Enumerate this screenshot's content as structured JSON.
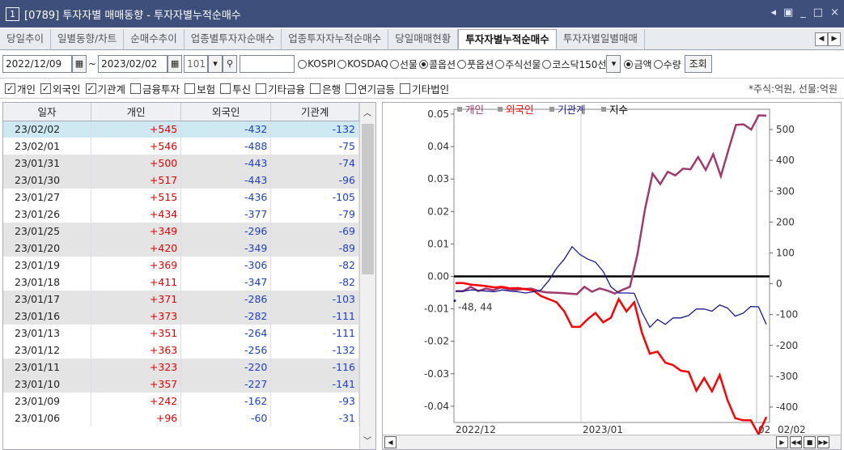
{
  "window": {
    "number": "1",
    "title": "[0789] 투자자별 매매동향 - 투자자별누적순매수"
  },
  "tabs": [
    "당일추이",
    "일별동향/차트",
    "순매수추이",
    "업종별투자자순매수",
    "업종투자자누적순매수",
    "당일매매현황",
    "투자자별누적순매수",
    "투자자별일별매매"
  ],
  "active_tab": 6,
  "toolbar": {
    "date_from": "2022/12/09",
    "date_to": "2023/02/02",
    "count": "101",
    "search_value": "",
    "markets": [
      "KOSPI",
      "KOSDAQ",
      "선물",
      "콜옵션",
      "풋옵션",
      "주식선물",
      "코스닥150선"
    ],
    "market_selected": 3,
    "units": [
      "금액",
      "수량"
    ],
    "unit_selected": 0,
    "query_label": "조회"
  },
  "checkboxes": [
    {
      "label": "개인",
      "checked": true
    },
    {
      "label": "외국인",
      "checked": true
    },
    {
      "label": "기관계",
      "checked": true
    },
    {
      "label": "금융투자",
      "checked": false
    },
    {
      "label": "보험",
      "checked": false
    },
    {
      "label": "투신",
      "checked": false
    },
    {
      "label": "기타금융",
      "checked": false
    },
    {
      "label": "은행",
      "checked": false
    },
    {
      "label": "연기금등",
      "checked": false
    },
    {
      "label": "기타법인",
      "checked": false
    }
  ],
  "unit_note": "*주식:억원, 선물:억원",
  "table": {
    "headers": [
      "일자",
      "개인",
      "외국인",
      "기관계"
    ],
    "rows": [
      [
        "23/02/02",
        "+545",
        "-432",
        "-132"
      ],
      [
        "23/02/01",
        "+546",
        "-488",
        "-75"
      ],
      [
        "23/01/31",
        "+500",
        "-443",
        "-74"
      ],
      [
        "23/01/30",
        "+517",
        "-443",
        "-96"
      ],
      [
        "23/01/27",
        "+515",
        "-436",
        "-105"
      ],
      [
        "23/01/26",
        "+434",
        "-377",
        "-79"
      ],
      [
        "23/01/25",
        "+349",
        "-296",
        "-69"
      ],
      [
        "23/01/20",
        "+420",
        "-349",
        "-89"
      ],
      [
        "23/01/19",
        "+369",
        "-306",
        "-82"
      ],
      [
        "23/01/18",
        "+411",
        "-347",
        "-82"
      ],
      [
        "23/01/17",
        "+371",
        "-286",
        "-103"
      ],
      [
        "23/01/16",
        "+373",
        "-282",
        "-111"
      ],
      [
        "23/01/13",
        "+351",
        "-264",
        "-111"
      ],
      [
        "23/01/12",
        "+363",
        "-256",
        "-132"
      ],
      [
        "23/01/11",
        "+323",
        "-220",
        "-116"
      ],
      [
        "23/01/10",
        "+357",
        "-227",
        "-141"
      ],
      [
        "23/01/09",
        "+242",
        "-162",
        "-93"
      ],
      [
        "23/01/06",
        "+96",
        "-60",
        "-31"
      ]
    ]
  },
  "chart_data": {
    "type": "line",
    "legend": [
      {
        "name": "개인",
        "color": "#a03a6e"
      },
      {
        "name": "외국인",
        "color": "#ff0000"
      },
      {
        "name": "기관계",
        "color": "#1a1a8c"
      },
      {
        "name": "지수",
        "color": "#000000"
      }
    ],
    "left_axis": {
      "ticks": [
        "0.05",
        "0.04",
        "0.03",
        "0.02",
        "0.01",
        "0.00",
        "-0.01",
        "-0.02",
        "-0.03",
        "-0.04"
      ],
      "ylim": [
        -0.045,
        0.05
      ]
    },
    "right_axis": {
      "ticks": [
        "500",
        "400",
        "300",
        "200",
        "100",
        "0",
        "-100",
        "-200",
        "-300",
        "-400"
      ],
      "ylim": [
        -450,
        550
      ]
    },
    "x_labels": [
      "2022/12",
      "2023/01",
      "02",
      "02/02"
    ],
    "annotation": "-48, 44",
    "index_level": 0.0,
    "series": [
      {
        "name": "개인",
        "values": [
          -24,
          -24,
          -10,
          -24,
          -16,
          -21,
          -12,
          -18,
          -20,
          -17,
          -16,
          -24,
          -28,
          -29,
          -30,
          -32,
          -34,
          -10,
          -26,
          -15,
          -22,
          -32,
          -20,
          -10,
          96,
          242,
          357,
          323,
          363,
          351,
          373,
          371,
          411,
          369,
          420,
          349,
          434,
          515,
          517,
          500,
          546,
          545
        ]
      },
      {
        "name": "외국인",
        "values": [
          2,
          2,
          -3,
          -5,
          -8,
          -12,
          -10,
          -15,
          -14,
          -18,
          -22,
          -40,
          -50,
          -60,
          -90,
          -140,
          -140,
          -115,
          -95,
          -125,
          -110,
          -50,
          -90,
          -60,
          -160,
          -227,
          -220,
          -256,
          -264,
          -282,
          -286,
          -347,
          -306,
          -349,
          -296,
          -377,
          -436,
          -443,
          -443,
          -488,
          -432
        ]
      },
      {
        "name": "기관계",
        "values": [
          -24,
          -24,
          -20,
          -22,
          -24,
          -26,
          -20,
          -24,
          -26,
          -30,
          -26,
          -20,
          10,
          50,
          80,
          120,
          95,
          80,
          70,
          40,
          -10,
          -30,
          -30,
          -31,
          -93,
          -141,
          -116,
          -132,
          -111,
          -111,
          -103,
          -82,
          -82,
          -89,
          -69,
          -79,
          -105,
          -96,
          -74,
          -75,
          -132
        ]
      }
    ]
  }
}
